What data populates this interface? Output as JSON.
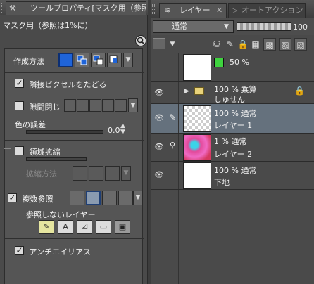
{
  "tool_panel": {
    "tab_title": "ツールプロパティ[マスク用（参照は",
    "subtitle": "マスク用（参照は1%に）",
    "creation_method_label": "作成方法",
    "follow_adjacent_label": "隣接ピクセルをたどる",
    "follow_adjacent_checked": true,
    "close_gap_label": "隙間閉じ",
    "close_gap_checked": false,
    "color_margin_label": "色の誤差",
    "color_margin_value": "0.0",
    "expand_area_label": "領域拡縮",
    "expand_area_checked": false,
    "expand_method_label": "拡縮方法",
    "multi_ref_label": "複数参照",
    "multi_ref_checked": true,
    "exclude_layers_label": "参照しないレイヤー",
    "antialias_label": "アンチエイリアス",
    "antialias_checked": true
  },
  "layer_panel": {
    "tab_layer": "レイヤー",
    "tab_auto_action": "オートアクション",
    "blend_mode": "通常",
    "opacity_value": "100",
    "layers": [
      {
        "line1": "50 %",
        "line2": "",
        "selected": false
      },
      {
        "line1": "100 % 乗算",
        "line2": "しゅせん",
        "selected": false
      },
      {
        "line1": "100 % 通常",
        "line2": "レイヤー 1",
        "selected": true
      },
      {
        "line1": "1 % 通常",
        "line2": "レイヤー 2",
        "selected": false
      },
      {
        "line1": "100 % 通常",
        "line2": "下地",
        "selected": false
      }
    ]
  },
  "colors": {
    "selection_blue": "#1f64d9",
    "selected_row": "#65717d",
    "background": "#4a4a4a"
  }
}
